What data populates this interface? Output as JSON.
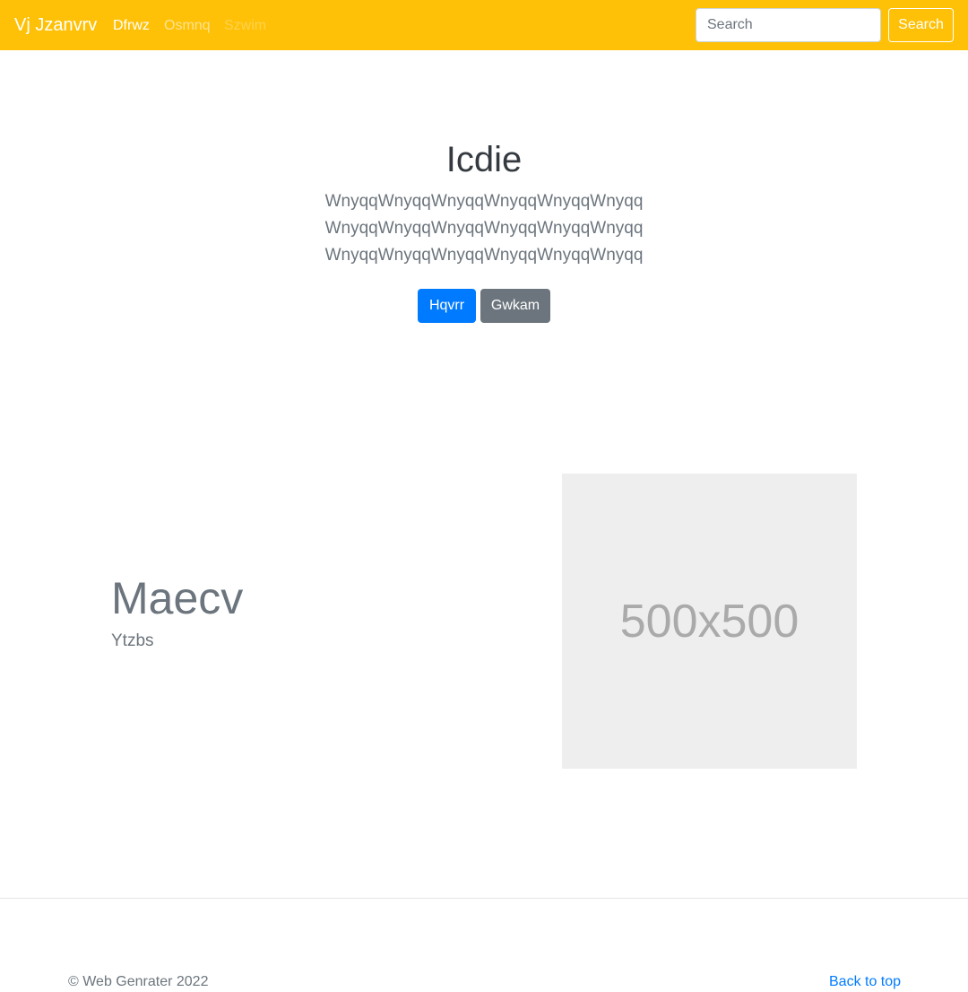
{
  "navbar": {
    "brand": "Vj Jzanvrv",
    "links": [
      {
        "label": "Dfrwz"
      },
      {
        "label": "Osmnq"
      },
      {
        "label": "Szwim"
      }
    ],
    "search_placeholder": "Search",
    "search_button": "Search",
    "bg_color": "#ffc107"
  },
  "hero": {
    "title": "Icdie",
    "lines": [
      "WnyqqWnyqqWnyqqWnyqqWnyqqWnyqq",
      "WnyqqWnyqqWnyqqWnyqqWnyqqWnyqq",
      "WnyqqWnyqqWnyqqWnyqqWnyqqWnyqq"
    ],
    "primary_button": "Hqvrr",
    "secondary_button": "Gwkam"
  },
  "feature": {
    "heading": "Maecv",
    "subheading": "Ytzbs",
    "image_label": "500x500"
  },
  "footer": {
    "copyright": "© Web Genrater 2022",
    "back_to_top": "Back to top"
  },
  "colors": {
    "primary": "#007bff",
    "secondary": "#6c757d",
    "navbar": "#ffc107"
  }
}
